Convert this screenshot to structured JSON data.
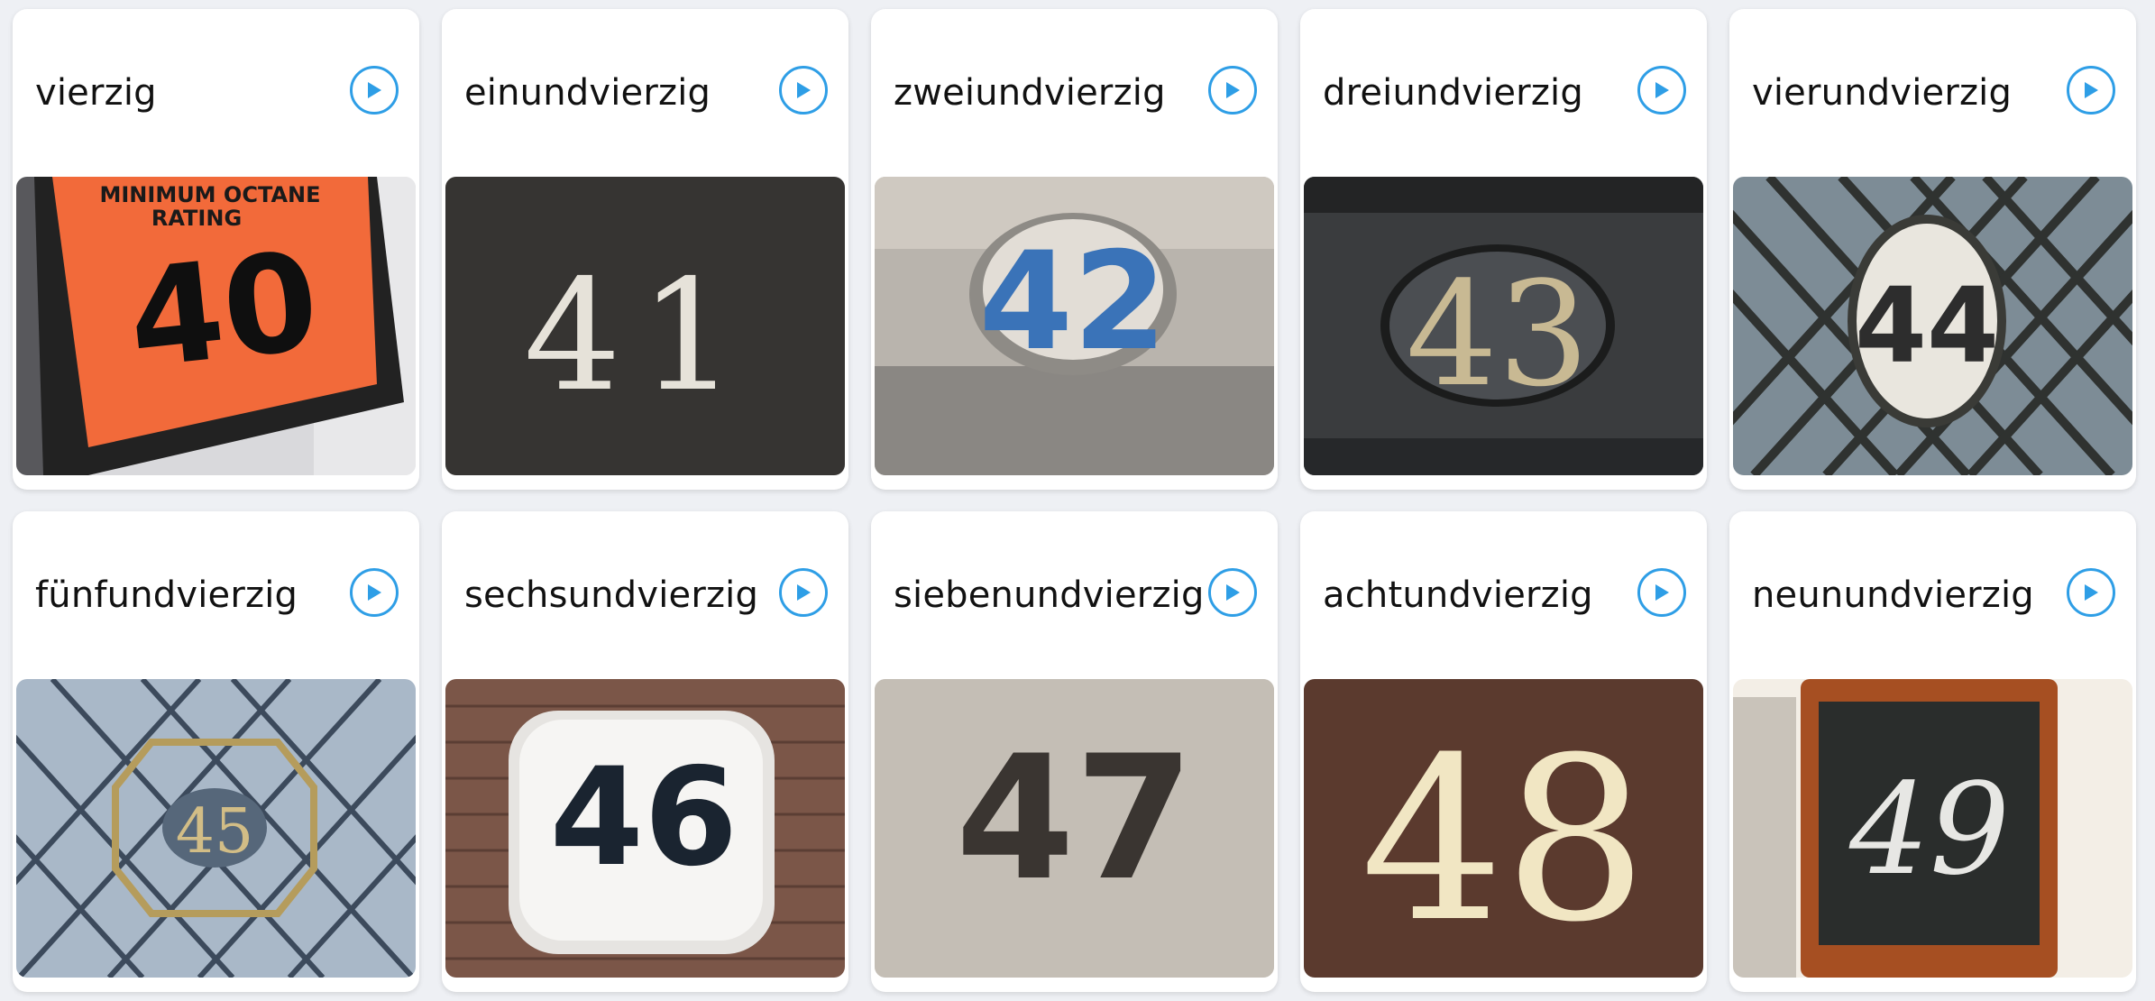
{
  "cards": [
    {
      "word": "vierzig",
      "number": "40"
    },
    {
      "word": "einundvierzig",
      "number": "41"
    },
    {
      "word": "zweiundvierzig",
      "number": "42"
    },
    {
      "word": "dreiundvierzig",
      "number": "43"
    },
    {
      "word": "vierundvierzig",
      "number": "44"
    },
    {
      "word": "fünfundvierzig",
      "number": "45"
    },
    {
      "word": "sechsundvierzig",
      "number": "46"
    },
    {
      "word": "siebenundvierzig",
      "number": "47"
    },
    {
      "word": "achtundvierzig",
      "number": "48"
    },
    {
      "word": "neunundvierzig",
      "number": "49"
    }
  ],
  "sign_40": {
    "line1": "MINIMUM OCTANE",
    "line2": "RATING"
  },
  "icons": {
    "play": "play-circle-icon"
  },
  "colors": {
    "accent": "#2e9ee6",
    "background": "#eef0f4",
    "card": "#ffffff"
  }
}
